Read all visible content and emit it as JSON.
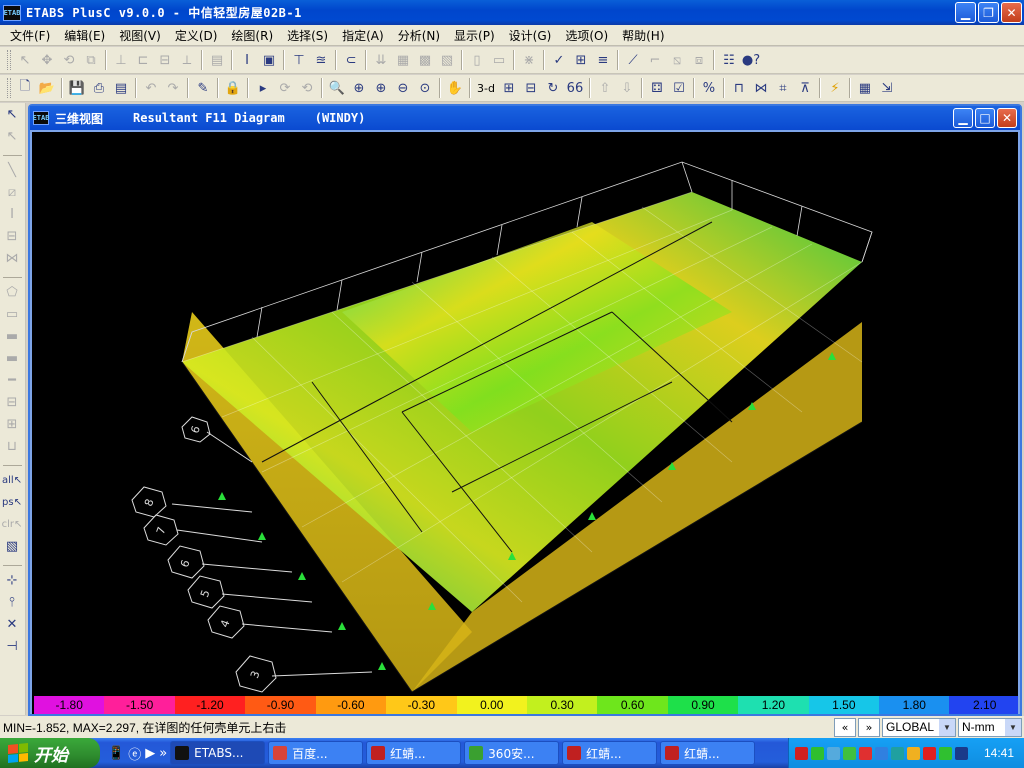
{
  "app": {
    "title": "ETABS PlusC v9.0.0 - 中信轻型房屋02B-1",
    "icon": "etabs-logo-icon"
  },
  "menu": [
    "文件(F)",
    "编辑(E)",
    "视图(V)",
    "定义(D)",
    "绘图(R)",
    "选择(S)",
    "指定(A)",
    "分析(N)",
    "显示(P)",
    "设计(G)",
    "选项(O)",
    "帮助(H)"
  ],
  "toolbar2": {
    "view3d": "3-d"
  },
  "window": {
    "name": "三维视图",
    "diagram": "Resultant F11 Diagram",
    "case": "(WINDY)"
  },
  "legend": {
    "labels": [
      "-1.80",
      "-1.50",
      "-1.20",
      "-0.90",
      "-0.60",
      "-0.30",
      "0.00",
      "0.30",
      "0.60",
      "0.90",
      "1.20",
      "1.50",
      "1.80",
      "2.10"
    ],
    "colors": [
      "#e011e0",
      "#ff1f9a",
      "#ff2020",
      "#ff5a14",
      "#ff9a10",
      "#ffc818",
      "#f2f21e",
      "#c2f01e",
      "#6ee61c",
      "#1ee04a",
      "#1ee0b0",
      "#16c6e8",
      "#1a90f0",
      "#2244f0"
    ]
  },
  "gridline_labels": [
    "6",
    "8",
    "7",
    "6",
    "5",
    "4",
    "3"
  ],
  "status": {
    "text": "MIN=-1.852, MAX=2.297, 在详图的任何壳单元上右击",
    "coord_system": "GLOBAL",
    "units": "N-mm"
  },
  "taskbar": {
    "start": "开始",
    "tasks": [
      {
        "label": "ETABS...",
        "color": "#111"
      },
      {
        "label": "百度...",
        "color": "#d8443a"
      },
      {
        "label": "红蜻...",
        "color": "#c02020"
      },
      {
        "label": "360安...",
        "color": "#3aa030"
      },
      {
        "label": "红蜻...",
        "color": "#c02020"
      },
      {
        "label": "红蜻...",
        "color": "#c02020"
      }
    ],
    "clock": "14:41"
  }
}
